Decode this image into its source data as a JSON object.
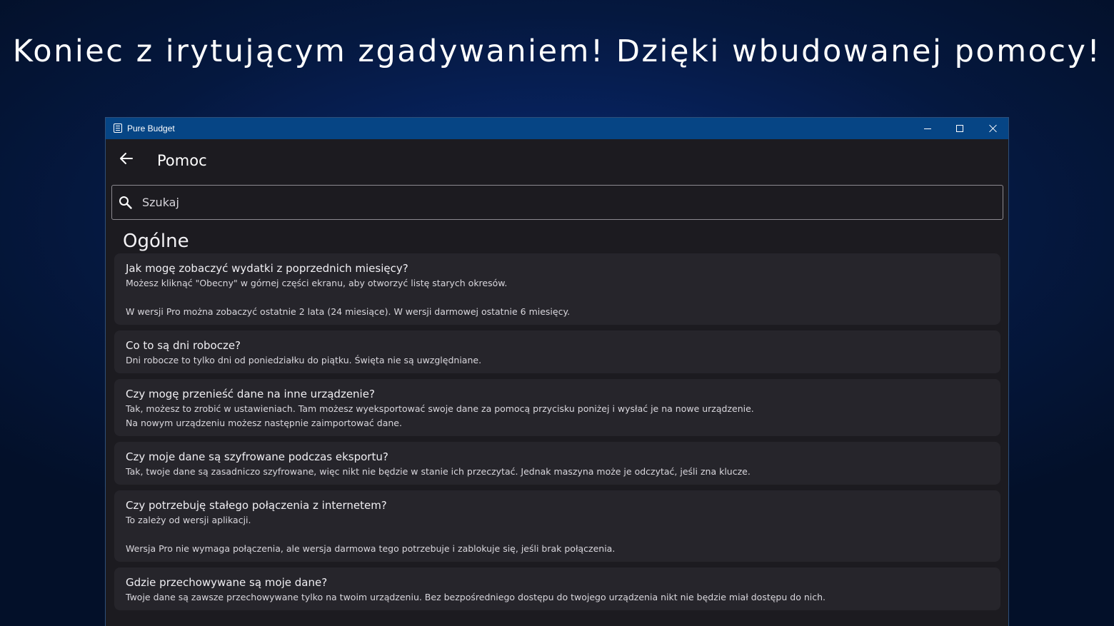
{
  "promo": {
    "headline": "Koniec z irytującym zgadywaniem! Dzięki wbudowanej pomocy!"
  },
  "window": {
    "title": "Pure Budget",
    "controls": [
      "minimize-icon",
      "maximize-icon",
      "close-icon"
    ]
  },
  "header": {
    "back_icon": "back-arrow-icon",
    "title": "Pomoc"
  },
  "search": {
    "placeholder": "Szukaj",
    "value": "",
    "icon": "search-icon"
  },
  "section": {
    "title": "Ogólne"
  },
  "faq": [
    {
      "question": "Jak mogę zobaczyć wydatki z poprzednich miesięcy?",
      "answer": "Możesz kliknąć \"Obecny\" w górnej części ekranu, aby otworzyć listę starych okresów.\n\nW wersji Pro można zobaczyć ostatnie 2 lata (24 miesiące). W wersji darmowej ostatnie 6 miesięcy."
    },
    {
      "question": "Co to są dni robocze?",
      "answer": "Dni robocze to tylko dni od poniedziałku do piątku. Święta nie są uwzględniane."
    },
    {
      "question": "Czy mogę przenieść dane na inne urządzenie?",
      "answer": "Tak, możesz to zrobić w ustawieniach. Tam możesz wyeksportować swoje dane za pomocą przycisku poniżej i wysłać je na nowe urządzenie.\nNa nowym urządzeniu możesz następnie zaimportować dane."
    },
    {
      "question": "Czy moje dane są szyfrowane podczas eksportu?",
      "answer": "Tak, twoje dane są zasadniczo szyfrowane, więc nikt nie będzie w stanie ich przeczytać. Jednak maszyna może je odczytać, jeśli zna klucze."
    },
    {
      "question": "Czy potrzebuję stałego połączenia z internetem?",
      "answer": "To zależy od wersji aplikacji.\n\nWersja Pro nie wymaga połączenia, ale wersja darmowa tego potrzebuje i zablokuje się, jeśli brak połączenia."
    },
    {
      "question": "Gdzie przechowywane są moje dane?",
      "answer": "Twoje dane są zawsze przechowywane tylko na twoim urządzeniu. Bez bezpośredniego dostępu do twojego urządzenia nikt nie będzie miał dostępu do nich."
    }
  ],
  "colors": {
    "titlebar": "#064585",
    "app_background": "#1c1b20",
    "card_background": "#26252b"
  }
}
